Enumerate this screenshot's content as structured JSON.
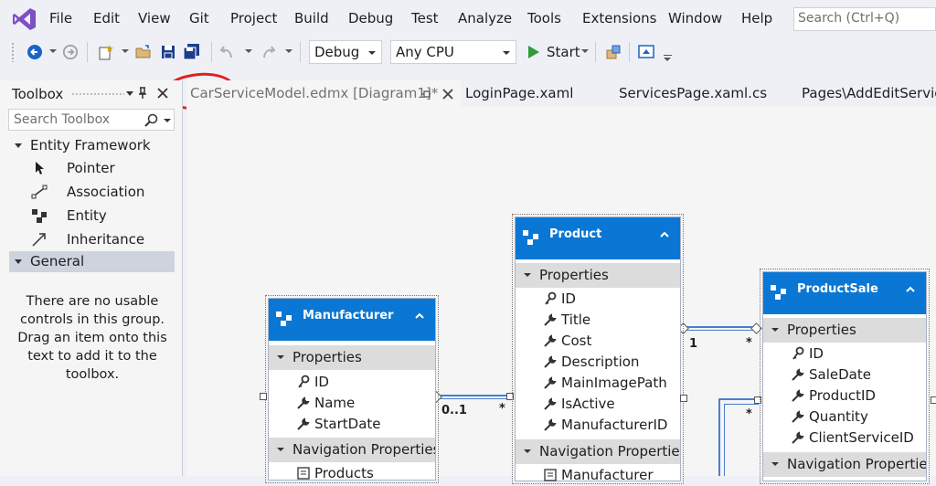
{
  "menu": {
    "items": [
      "File",
      "Edit",
      "View",
      "Git",
      "Project",
      "Build",
      "Debug",
      "Test",
      "Analyze",
      "Tools",
      "Extensions",
      "Window",
      "Help"
    ],
    "search_placeholder": "Search (Ctrl+Q)"
  },
  "toolbar": {
    "config": "Debug",
    "platform": "Any CPU",
    "start_label": "Start",
    "icons": [
      "back-icon",
      "forward-icon",
      "new-project-icon",
      "open-file-icon",
      "save-icon",
      "save-all-icon",
      "undo-icon",
      "redo-icon",
      "start-icon",
      "find-icon",
      "browser-icon"
    ],
    "accent_color": "#e02020"
  },
  "toolbox": {
    "title": "Toolbox",
    "search_placeholder": "Search Toolbox",
    "groups": [
      {
        "label": "Entity Framework",
        "items": [
          {
            "label": "Pointer",
            "icon": "pointer-icon"
          },
          {
            "label": "Association",
            "icon": "association-icon"
          },
          {
            "label": "Entity",
            "icon": "entity-icon"
          },
          {
            "label": "Inheritance",
            "icon": "inheritance-icon"
          }
        ]
      },
      {
        "label": "General",
        "items": []
      }
    ],
    "empty_message": "There are no usable controls in this group. Drag an item onto this text to add it to the toolbox."
  },
  "tabs": [
    {
      "label": "CarServiceModel.edmx [Diagram1]*",
      "active": true
    },
    {
      "label": "LoginPage.xaml",
      "active": false
    },
    {
      "label": "ServicesPage.xaml.cs",
      "active": false
    },
    {
      "label": "Pages\\AddEditServicel",
      "active": false
    }
  ],
  "diagram": {
    "header_color": "#0a77d4",
    "entities": {
      "manufacturer": {
        "title": "Manufacturer",
        "properties_label": "Properties",
        "properties": [
          "ID",
          "Name",
          "StartDate"
        ],
        "nav_label": "Navigation Properties",
        "nav": [
          "Products"
        ]
      },
      "product": {
        "title": "Product",
        "properties_label": "Properties",
        "properties": [
          "ID",
          "Title",
          "Cost",
          "Description",
          "MainImagePath",
          "IsActive",
          "ManufacturerID"
        ],
        "nav_label": "Navigation Properties",
        "nav": [
          "Manufacturer"
        ]
      },
      "productsale": {
        "title": "ProductSale",
        "properties_label": "Properties",
        "properties": [
          "ID",
          "SaleDate",
          "ProductID",
          "Quantity",
          "ClientServiceID"
        ],
        "nav_label": "Navigation Properties"
      }
    },
    "multiplicities": {
      "manufacturer_side": "0..1",
      "product_many": "*",
      "product_one": "1",
      "sale_many": "*",
      "sale_many_2": "*"
    }
  }
}
